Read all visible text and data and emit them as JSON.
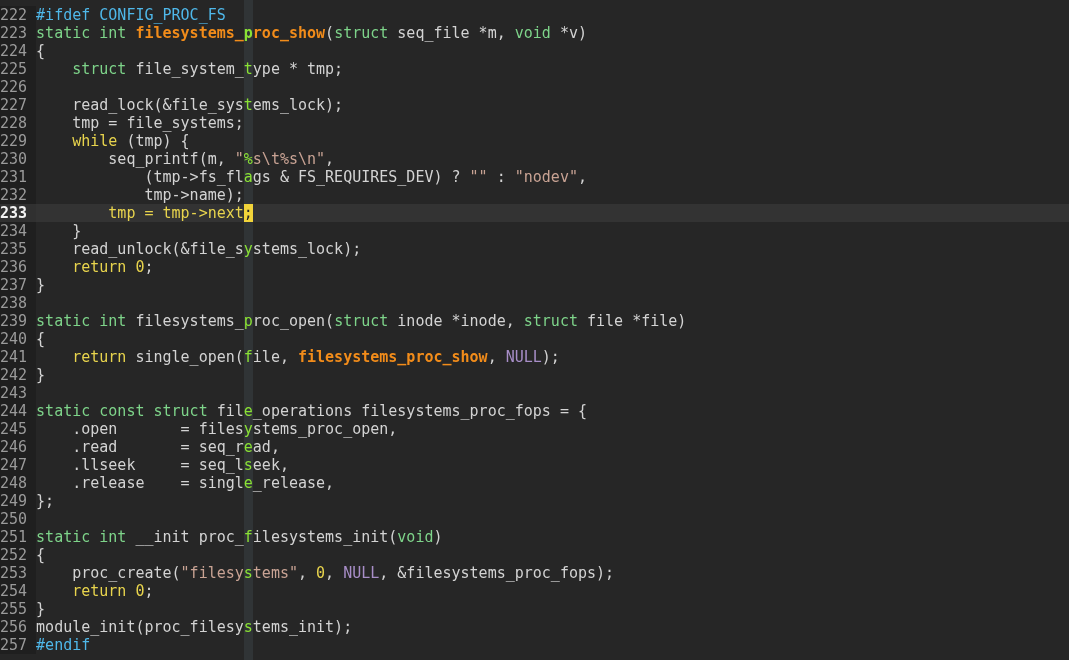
{
  "lines": [
    {
      "number": "222",
      "current": false,
      "tokens": [
        {
          "text": "#ifdef CONFIG_PROC_FS",
          "kind": "preproc"
        }
      ]
    },
    {
      "number": "223",
      "current": false,
      "tokens": [
        {
          "text": "static",
          "kind": "keyword"
        },
        {
          "text": " int",
          "kind": "keyword"
        },
        {
          "text": " filesystems_proc_show",
          "kind": "function"
        },
        {
          "text": "(",
          "kind": "plain"
        },
        {
          "text": "struct",
          "kind": "keyword"
        },
        {
          "text": " seq_file *m, ",
          "kind": "plain"
        },
        {
          "text": "void",
          "kind": "keyword"
        },
        {
          "text": " *v)",
          "kind": "plain"
        }
      ]
    },
    {
      "number": "224",
      "current": false,
      "tokens": [
        {
          "text": "{",
          "kind": "plain"
        }
      ]
    },
    {
      "number": "225",
      "current": false,
      "tokens": [
        {
          "text": "    struct",
          "kind": "keyword"
        },
        {
          "text": " file_system_type * tmp;",
          "kind": "plain"
        }
      ]
    },
    {
      "number": "226",
      "current": false
    },
    {
      "number": "227",
      "current": false,
      "tokens": [
        {
          "text": "    read_lock(&file_systems_lock);",
          "kind": "plain"
        }
      ]
    },
    {
      "number": "228",
      "current": false,
      "tokens": [
        {
          "text": "    tmp = file_systems;",
          "kind": "plain"
        }
      ]
    },
    {
      "number": "229",
      "current": false,
      "tokens": [
        {
          "text": "    while",
          "kind": "control"
        },
        {
          "text": " (tmp) {",
          "kind": "plain"
        }
      ]
    },
    {
      "number": "230",
      "current": false,
      "tokens": [
        {
          "text": "        seq_printf(m, ",
          "kind": "plain"
        },
        {
          "text": "\"%s\\t%s\\n\"",
          "kind": "string"
        },
        {
          "text": ",",
          "kind": "plain"
        }
      ]
    },
    {
      "number": "231",
      "current": false,
      "tokens": [
        {
          "text": "            (tmp->fs_flags & FS_REQUIRES_DEV) ? ",
          "kind": "plain"
        },
        {
          "text": "\"\"",
          "kind": "string"
        },
        {
          "text": " : ",
          "kind": "plain"
        },
        {
          "text": "\"nodev\"",
          "kind": "string"
        },
        {
          "text": ",",
          "kind": "plain"
        }
      ]
    },
    {
      "number": "232",
      "current": false,
      "tokens": [
        {
          "text": "            tmp->name);",
          "kind": "plain"
        }
      ]
    },
    {
      "number": "233",
      "current": true,
      "tokens": [
        {
          "text": "        tmp = tmp->next",
          "kind": "highlight"
        },
        {
          "text": ";",
          "kind": "cursor"
        }
      ]
    },
    {
      "number": "234",
      "current": false,
      "tokens": [
        {
          "text": "    }",
          "kind": "plain"
        }
      ]
    },
    {
      "number": "235",
      "current": false,
      "tokens": [
        {
          "text": "    read_unlock(&file_systems_lock);",
          "kind": "plain"
        }
      ]
    },
    {
      "number": "236",
      "current": false,
      "tokens": [
        {
          "text": "    return",
          "kind": "control"
        },
        {
          "text": " 0",
          "kind": "number"
        },
        {
          "text": ";",
          "kind": "plain"
        }
      ]
    },
    {
      "number": "237",
      "current": false,
      "tokens": [
        {
          "text": "}",
          "kind": "plain"
        }
      ]
    },
    {
      "number": "238",
      "current": false
    },
    {
      "number": "239",
      "current": false,
      "tokens": [
        {
          "text": "static",
          "kind": "keyword"
        },
        {
          "text": " int",
          "kind": "keyword"
        },
        {
          "text": " filesystems_proc_open(",
          "kind": "plain"
        },
        {
          "text": "struct",
          "kind": "keyword"
        },
        {
          "text": " inode *inode, ",
          "kind": "plain"
        },
        {
          "text": "struct",
          "kind": "keyword"
        },
        {
          "text": " file *file)",
          "kind": "plain"
        }
      ]
    },
    {
      "number": "240",
      "current": false,
      "tokens": [
        {
          "text": "{",
          "kind": "plain"
        }
      ]
    },
    {
      "number": "241",
      "current": false,
      "tokens": [
        {
          "text": "    return",
          "kind": "control"
        },
        {
          "text": " single_open(file, ",
          "kind": "plain"
        },
        {
          "text": "filesystems_proc_show",
          "kind": "function"
        },
        {
          "text": ", ",
          "kind": "plain"
        },
        {
          "text": "NULL",
          "kind": "constant"
        },
        {
          "text": ");",
          "kind": "plain"
        }
      ]
    },
    {
      "number": "242",
      "current": false,
      "tokens": [
        {
          "text": "}",
          "kind": "plain"
        }
      ]
    },
    {
      "number": "243",
      "current": false
    },
    {
      "number": "244",
      "current": false,
      "tokens": [
        {
          "text": "static",
          "kind": "keyword"
        },
        {
          "text": " const",
          "kind": "keyword"
        },
        {
          "text": " struct",
          "kind": "keyword"
        },
        {
          "text": " file_operations filesystems_proc_fops = {",
          "kind": "plain"
        }
      ]
    },
    {
      "number": "245",
      "current": false,
      "tokens": [
        {
          "text": "    .open       = filesystems_proc_open,",
          "kind": "plain"
        }
      ]
    },
    {
      "number": "246",
      "current": false,
      "tokens": [
        {
          "text": "    .read       = seq_read,",
          "kind": "plain"
        }
      ]
    },
    {
      "number": "247",
      "current": false,
      "tokens": [
        {
          "text": "    .llseek     = seq_lseek,",
          "kind": "plain"
        }
      ]
    },
    {
      "number": "248",
      "current": false,
      "tokens": [
        {
          "text": "    .release    = single_release,",
          "kind": "plain"
        }
      ]
    },
    {
      "number": "249",
      "current": false,
      "tokens": [
        {
          "text": "};",
          "kind": "plain"
        }
      ]
    },
    {
      "number": "250",
      "current": false
    },
    {
      "number": "251",
      "current": false,
      "tokens": [
        {
          "text": "static",
          "kind": "keyword"
        },
        {
          "text": " int",
          "kind": "keyword"
        },
        {
          "text": " __init proc_filesystems_init(",
          "kind": "plain"
        },
        {
          "text": "void",
          "kind": "keyword"
        },
        {
          "text": ")",
          "kind": "plain"
        }
      ]
    },
    {
      "number": "252",
      "current": false,
      "tokens": [
        {
          "text": "{",
          "kind": "plain"
        }
      ]
    },
    {
      "number": "253",
      "current": false,
      "tokens": [
        {
          "text": "    proc_create(",
          "kind": "plain"
        },
        {
          "text": "\"filesystems\"",
          "kind": "string"
        },
        {
          "text": ", ",
          "kind": "plain"
        },
        {
          "text": "0",
          "kind": "number"
        },
        {
          "text": ", ",
          "kind": "plain"
        },
        {
          "text": "NULL",
          "kind": "constant"
        },
        {
          "text": ", &filesystems_proc_fops);",
          "kind": "plain"
        }
      ]
    },
    {
      "number": "254",
      "current": false,
      "tokens": [
        {
          "text": "    return",
          "kind": "control"
        },
        {
          "text": " 0",
          "kind": "number"
        },
        {
          "text": ";",
          "kind": "plain"
        }
      ]
    },
    {
      "number": "255",
      "current": false,
      "tokens": [
        {
          "text": "}",
          "kind": "plain"
        }
      ]
    },
    {
      "number": "256",
      "current": false,
      "tokens": [
        {
          "text": "module_init(proc_filesystems_init);",
          "kind": "plain"
        }
      ]
    },
    {
      "number": "257",
      "current": false,
      "tokens": [
        {
          "text": "#endif",
          "kind": "preproc"
        }
      ]
    }
  ]
}
